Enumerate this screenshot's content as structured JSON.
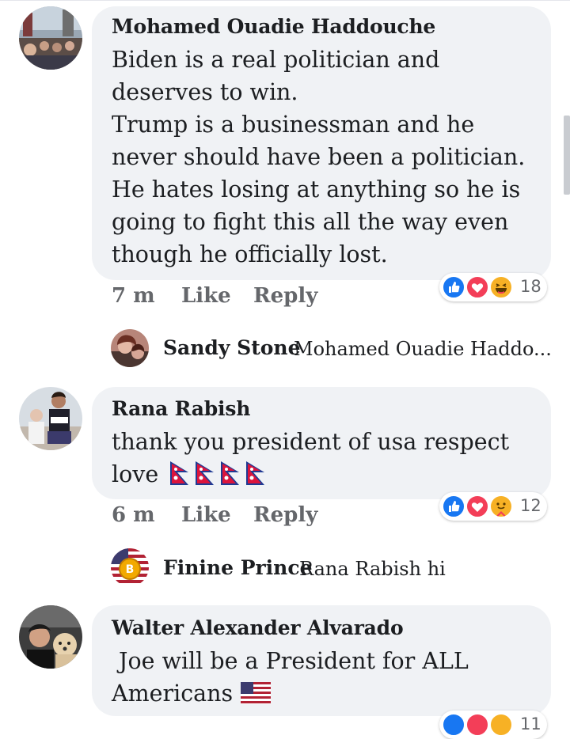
{
  "comments": [
    {
      "author": "Mohamed Ouadie Haddouche",
      "text": "Biden is a real politician and\ndeserves to win.\nTrump is a businessman and he\nnever should have been a politician.\nHe hates losing at anything so he is\ngoing to fight this all the way even\nthough he officially lost.",
      "time": "7 m",
      "like_label": "Like",
      "reply_label": "Reply",
      "reaction_count": "18",
      "reactions": [
        "like-reaction",
        "love-reaction",
        "haha-reaction"
      ],
      "reply": {
        "author": "Sandy Stone",
        "text": "Mohamed Ouadie Haddo..."
      }
    },
    {
      "author": "Rana Rabish",
      "text": "thank you president of usa respect\nlove",
      "time": "6 m",
      "like_label": "Like",
      "reply_label": "Reply",
      "reaction_count": "12",
      "reactions": [
        "like-reaction",
        "love-reaction",
        "care-reaction"
      ],
      "emoji": [
        "nepal-flag",
        "nepal-flag",
        "nepal-flag",
        "nepal-flag"
      ],
      "reply": {
        "author": "Finine Prince",
        "text": "Rana Rabish hi"
      }
    },
    {
      "author": "Walter Alexander Alvarado",
      "text": " Joe will be a President for ALL\nAmericans",
      "emoji": [
        "us-flag"
      ],
      "reaction_count": "11",
      "reactions": [
        "like-reaction",
        "love-reaction",
        "care-reaction"
      ]
    }
  ],
  "colors": {
    "bubble": "#f0f2f5",
    "like_blue": "#1877f2",
    "love_red": "#f33e58",
    "haha_yellow": "#f7b125",
    "meta_gray": "#65676b"
  }
}
